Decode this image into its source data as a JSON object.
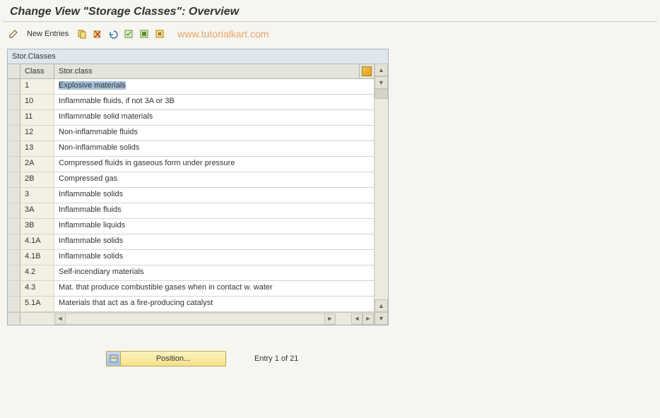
{
  "page": {
    "title": "Change View \"Storage Classes\": Overview"
  },
  "watermark": "www.tutorialkart.com",
  "toolbar": {
    "new_entries_label": "New Entries"
  },
  "panel": {
    "title": "Stor.Classes",
    "col_class": "Class",
    "col_desc": "Stor.class"
  },
  "rows": [
    {
      "class": "1",
      "desc": "Explosive materials",
      "selected": true
    },
    {
      "class": "10",
      "desc": "Inflammable fluids, if not 3A or 3B"
    },
    {
      "class": "11",
      "desc": "Inflammable solid materials"
    },
    {
      "class": "12",
      "desc": "Non-inflammable fluids"
    },
    {
      "class": "13",
      "desc": "Non-inflammable solids"
    },
    {
      "class": "2A",
      "desc": "Compressed fluids in gaseous form under pressure"
    },
    {
      "class": "2B",
      "desc": "Compressed gas"
    },
    {
      "class": "3",
      "desc": "Inflammable solids"
    },
    {
      "class": "3A",
      "desc": "Inflammable fluids"
    },
    {
      "class": "3B",
      "desc": "Inflammable liquids"
    },
    {
      "class": "4.1A",
      "desc": "Inflammable solids"
    },
    {
      "class": "4.1B",
      "desc": "Inflammable solids"
    },
    {
      "class": "4.2",
      "desc": "Self-incendiary materials"
    },
    {
      "class": "4.3",
      "desc": "Mat. that produce combustible gases when in contact w. water"
    },
    {
      "class": "5.1A",
      "desc": "Materials that act as a fire-producing catalyst"
    }
  ],
  "footer": {
    "position_label": "Position...",
    "entry_info": "Entry 1 of 21"
  }
}
